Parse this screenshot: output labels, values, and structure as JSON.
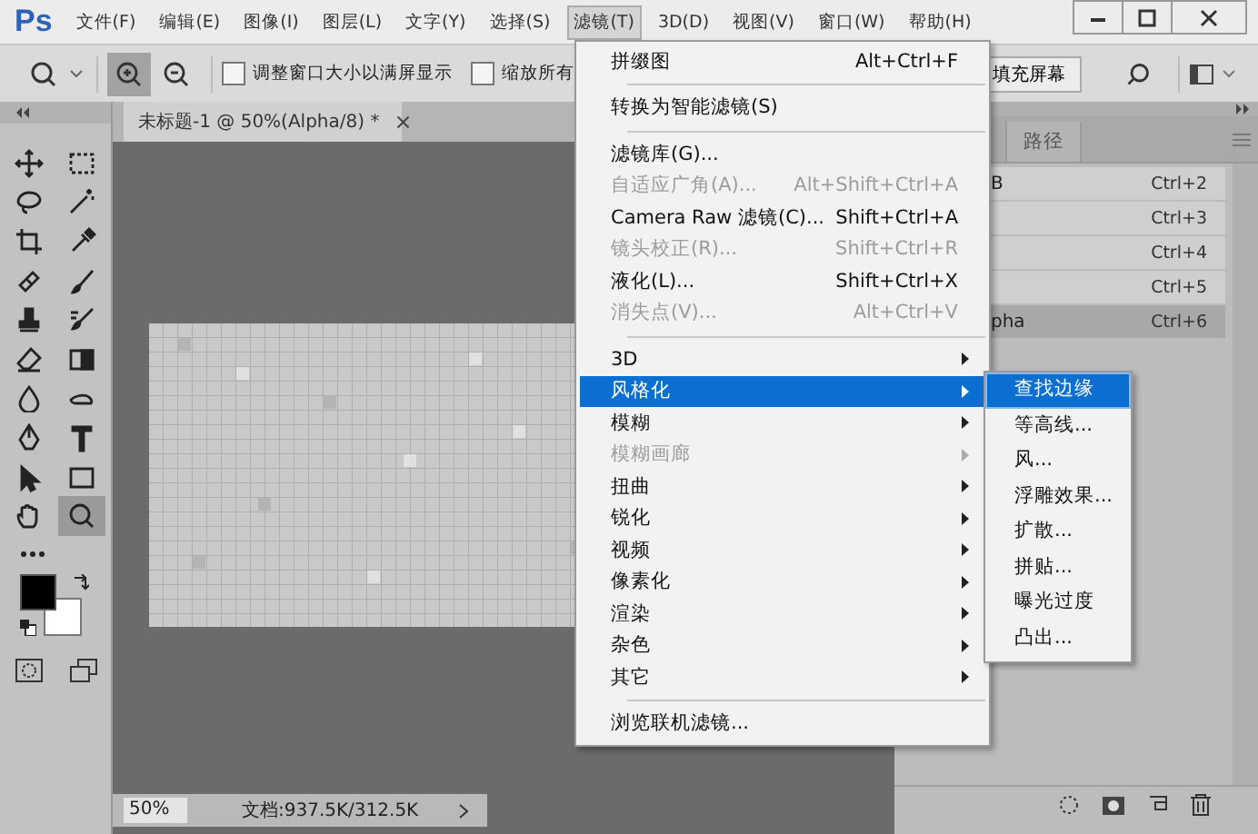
{
  "menubar": {
    "logo": "Ps",
    "items": [
      {
        "label": "文件(F)",
        "selected": false
      },
      {
        "label": "编辑(E)",
        "selected": false
      },
      {
        "label": "图像(I)",
        "selected": false
      },
      {
        "label": "图层(L)",
        "selected": false
      },
      {
        "label": "文字(Y)",
        "selected": false
      },
      {
        "label": "选择(S)",
        "selected": false
      },
      {
        "label": "滤镜(T)",
        "selected": true
      },
      {
        "label": "3D(D)",
        "selected": false
      },
      {
        "label": "视图(V)",
        "selected": false
      },
      {
        "label": "窗口(W)",
        "selected": false
      },
      {
        "label": "帮助(H)",
        "selected": false
      }
    ]
  },
  "options_bar": {
    "zoom_buttons": [
      {
        "kind": "zoom-in",
        "selected": true
      },
      {
        "kind": "zoom-out",
        "selected": false
      }
    ],
    "checkboxes": [
      {
        "label": "调整窗口大小以满屏显示",
        "checked": false
      },
      {
        "label": "缩放所有",
        "checked": false
      }
    ],
    "fill_screen_button": "填充屏幕"
  },
  "toolbox": {
    "tools": [
      {
        "kind": "move",
        "selected": false
      },
      {
        "kind": "marquee",
        "selected": false
      },
      {
        "kind": "lasso",
        "selected": false
      },
      {
        "kind": "wand",
        "selected": false
      },
      {
        "kind": "crop",
        "selected": false
      },
      {
        "kind": "eyedropper",
        "selected": false
      },
      {
        "kind": "healing",
        "selected": false
      },
      {
        "kind": "brush",
        "selected": false
      },
      {
        "kind": "stamp",
        "selected": false
      },
      {
        "kind": "history",
        "selected": false
      },
      {
        "kind": "eraser",
        "selected": false
      },
      {
        "kind": "gradient",
        "selected": false
      },
      {
        "kind": "blur",
        "selected": false
      },
      {
        "kind": "smudge",
        "selected": false
      },
      {
        "kind": "pen",
        "selected": false
      },
      {
        "kind": "type",
        "selected": false
      },
      {
        "kind": "select",
        "selected": false
      },
      {
        "kind": "rect",
        "selected": false
      },
      {
        "kind": "hand",
        "selected": false
      },
      {
        "kind": "zoom",
        "selected": true
      }
    ]
  },
  "document": {
    "tab": "未标题-1 @ 50%(Alpha/8) *",
    "close": "×",
    "zoom": "50%",
    "info": "文档:937.5K/312.5K"
  },
  "panel": {
    "tabs": [
      {
        "label": "路径",
        "selected": false
      }
    ],
    "rows": [
      {
        "name": "B",
        "shortcut": "Ctrl+2",
        "selected": false
      },
      {
        "shortcut": "Ctrl+3",
        "selected": false
      },
      {
        "shortcut": "Ctrl+4",
        "selected": false
      },
      {
        "shortcut": "Ctrl+5",
        "selected": false
      },
      {
        "name": "pha",
        "shortcut": "Ctrl+6",
        "selected": true
      }
    ]
  },
  "filter_menu": {
    "items": [
      {
        "kind": "item",
        "label": "拼缀图",
        "shortcut": "Alt+Ctrl+F",
        "disabled": false
      },
      {
        "kind": "separator"
      },
      {
        "kind": "item",
        "label": "转换为智能滤镜(S)",
        "disabled": false
      },
      {
        "kind": "separator"
      },
      {
        "kind": "item",
        "label": "滤镜库(G)...",
        "disabled": false
      },
      {
        "kind": "item",
        "label": "自适应广角(A)...",
        "shortcut": "Alt+Shift+Ctrl+A",
        "disabled": true
      },
      {
        "kind": "item",
        "label": "Camera Raw 滤镜(C)...",
        "shortcut": "Shift+Ctrl+A",
        "disabled": false
      },
      {
        "kind": "item",
        "label": "镜头校正(R)...",
        "shortcut": "Shift+Ctrl+R",
        "disabled": true
      },
      {
        "kind": "item",
        "label": "液化(L)...",
        "shortcut": "Shift+Ctrl+X",
        "disabled": false
      },
      {
        "kind": "item",
        "label": "消失点(V)...",
        "shortcut": "Alt+Ctrl+V",
        "disabled": true
      },
      {
        "kind": "separator"
      },
      {
        "kind": "submenu",
        "label": "3D",
        "disabled": false,
        "selected": false
      },
      {
        "kind": "submenu",
        "label": "风格化",
        "disabled": false,
        "selected": true
      },
      {
        "kind": "submenu",
        "label": "模糊",
        "disabled": false,
        "selected": false
      },
      {
        "kind": "submenu",
        "label": "模糊画廊",
        "disabled": true,
        "selected": false
      },
      {
        "kind": "submenu",
        "label": "扭曲",
        "disabled": false,
        "selected": false
      },
      {
        "kind": "submenu",
        "label": "锐化",
        "disabled": false,
        "selected": false
      },
      {
        "kind": "submenu",
        "label": "视频",
        "disabled": false,
        "selected": false
      },
      {
        "kind": "submenu",
        "label": "像素化",
        "disabled": false,
        "selected": false
      },
      {
        "kind": "submenu",
        "label": "渲染",
        "disabled": false,
        "selected": false
      },
      {
        "kind": "submenu",
        "label": "杂色",
        "disabled": false,
        "selected": false
      },
      {
        "kind": "submenu",
        "label": "其它",
        "disabled": false,
        "selected": false
      },
      {
        "kind": "separator"
      },
      {
        "kind": "item",
        "label": "浏览联机滤镜...",
        "disabled": false
      }
    ]
  },
  "submenu": {
    "items": [
      {
        "label": "查找边缘",
        "selected": true
      },
      {
        "label": "等高线...",
        "selected": false
      },
      {
        "label": "风...",
        "selected": false
      },
      {
        "label": "浮雕效果...",
        "selected": false
      },
      {
        "label": "扩散...",
        "selected": false
      },
      {
        "label": "拼贴...",
        "selected": false
      },
      {
        "label": "曝光过度",
        "selected": false
      },
      {
        "label": "凸出...",
        "selected": false
      }
    ]
  }
}
